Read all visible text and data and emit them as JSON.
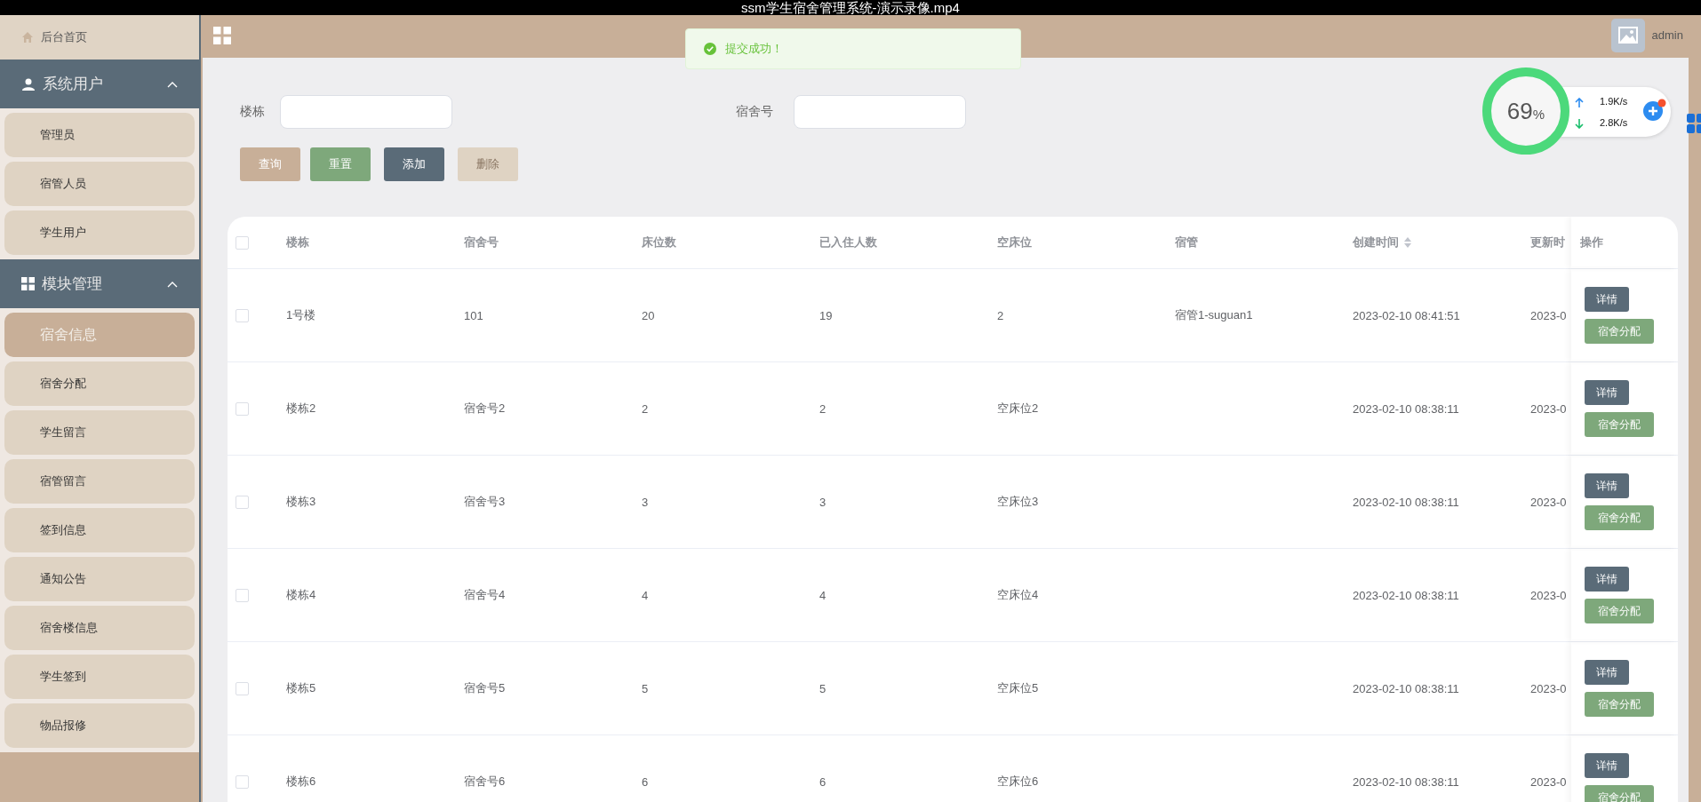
{
  "video_bar": {
    "title": "ssm学生宿舍管理系统-演示录像.mp4"
  },
  "header": {
    "user": "admin"
  },
  "toast": {
    "message": "提交成功！"
  },
  "sidebar": {
    "home": "后台首页",
    "sections": [
      {
        "title": "系统用户",
        "expanded": true,
        "kind": "user",
        "items": [
          {
            "label": "管理员",
            "selected": false
          },
          {
            "label": "宿管人员",
            "selected": false
          },
          {
            "label": "学生用户",
            "selected": false
          }
        ]
      },
      {
        "title": "模块管理",
        "expanded": true,
        "kind": "grid",
        "items": [
          {
            "label": "宿舍信息",
            "selected": true
          },
          {
            "label": "宿舍分配",
            "selected": false
          },
          {
            "label": "学生留言",
            "selected": false
          },
          {
            "label": "宿管留言",
            "selected": false
          },
          {
            "label": "签到信息",
            "selected": false
          },
          {
            "label": "通知公告",
            "selected": false
          },
          {
            "label": "宿舍楼信息",
            "selected": false
          },
          {
            "label": "学生签到",
            "selected": false
          },
          {
            "label": "物品报修",
            "selected": false
          }
        ]
      }
    ]
  },
  "search": {
    "fields": [
      {
        "label": "楼栋"
      },
      {
        "label": "宿舍号"
      }
    ],
    "buttons": [
      {
        "label": "查询",
        "kind": "query",
        "disabled": false
      },
      {
        "label": "重置",
        "kind": "reset",
        "disabled": false
      },
      {
        "label": "添加",
        "kind": "add",
        "disabled": false
      },
      {
        "label": "删除",
        "kind": "delete",
        "disabled": true
      }
    ]
  },
  "table": {
    "select_all_checked": false,
    "columns": [
      "楼栋",
      "宿舍号",
      "床位数",
      "已入住人数",
      "空床位",
      "宿管",
      "创建时间",
      "更新时"
    ],
    "actions_header": "操作",
    "rows": [
      {
        "checked": false,
        "cells": [
          "1号楼",
          "101",
          "20",
          "19",
          "2",
          "宿管1-suguan1",
          "2023-02-10 08:41:51",
          "2023-0"
        ],
        "actions": [
          "详情",
          "宿舍分配"
        ]
      },
      {
        "checked": false,
        "cells": [
          "楼栋2",
          "宿舍号2",
          "2",
          "2",
          "空床位2",
          "",
          "2023-02-10 08:38:11",
          "2023-0"
        ],
        "actions": [
          "详情",
          "宿舍分配"
        ]
      },
      {
        "checked": false,
        "cells": [
          "楼栋3",
          "宿舍号3",
          "3",
          "3",
          "空床位3",
          "",
          "2023-02-10 08:38:11",
          "2023-0"
        ],
        "actions": [
          "详情",
          "宿舍分配"
        ]
      },
      {
        "checked": false,
        "cells": [
          "楼栋4",
          "宿舍号4",
          "4",
          "4",
          "空床位4",
          "",
          "2023-02-10 08:38:11",
          "2023-0"
        ],
        "actions": [
          "详情",
          "宿舍分配"
        ]
      },
      {
        "checked": false,
        "cells": [
          "楼栋5",
          "宿舍号5",
          "5",
          "5",
          "空床位5",
          "",
          "2023-02-10 08:38:11",
          "2023-0"
        ],
        "actions": [
          "详情",
          "宿舍分配"
        ]
      },
      {
        "checked": false,
        "cells": [
          "楼栋6",
          "宿舍号6",
          "6",
          "6",
          "空床位6",
          "",
          "2023-02-10 08:38:11",
          "2023-0"
        ],
        "actions": [
          "详情",
          "宿舍分配"
        ]
      }
    ]
  },
  "speed_widget": {
    "percent": "69",
    "unit": "%",
    "upload": "1.9K/s",
    "download": "2.8K/s"
  }
}
